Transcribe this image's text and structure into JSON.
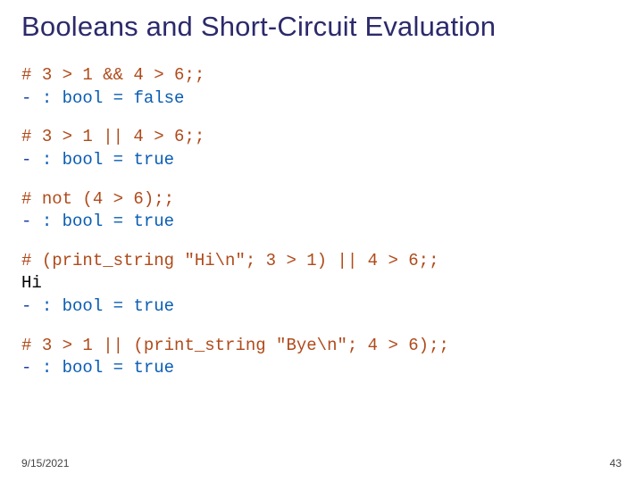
{
  "title": "Booleans and Short-Circuit Evaluation",
  "blocks": [
    {
      "prompt": "# ",
      "expr": "3 > 1 && 4 > 6;;",
      "out_prefix": "- ",
      "out_type": ": bool = ",
      "out_val": "false",
      "extra": ""
    },
    {
      "prompt": "# ",
      "expr": "3 > 1 || 4 > 6;;",
      "out_prefix": "- ",
      "out_type": ": bool = ",
      "out_val": "true",
      "extra": ""
    },
    {
      "prompt": "# ",
      "expr": "not (4 > 6);;",
      "out_prefix": "- ",
      "out_type": ": bool = ",
      "out_val": "true",
      "extra": ""
    },
    {
      "prompt": "# ",
      "expr": "(print_string \"Hi\\n\"; 3 > 1) || 4 > 6;;",
      "out_prefix": "- ",
      "out_type": ": bool = ",
      "out_val": "true",
      "extra": "Hi"
    },
    {
      "prompt": "# ",
      "expr": "3 > 1 || (print_string \"Bye\\n\"; 4 > 6);;",
      "out_prefix": "- ",
      "out_type": ": bool = ",
      "out_val": "true",
      "extra": ""
    }
  ],
  "footer": {
    "date": "9/15/2021",
    "page": "43"
  }
}
